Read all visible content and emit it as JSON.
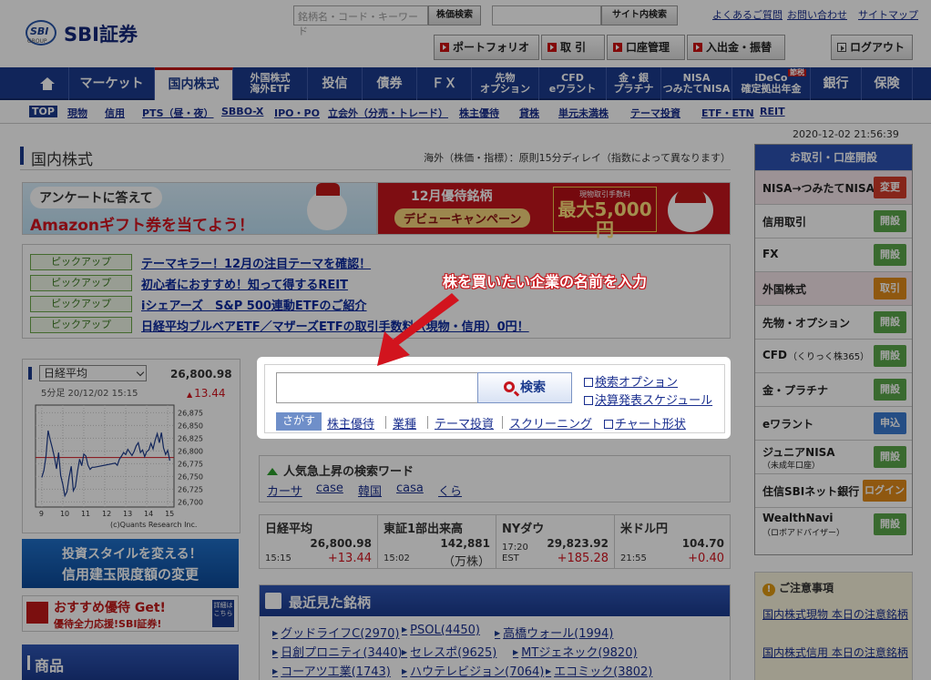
{
  "header": {
    "logo_badge": "SBI",
    "logo_sub": "GROUP",
    "logo_text": "SBI証券",
    "stock_search_placeholder": "銘柄名・コード・キーワード",
    "stock_search_btn": "株価検索",
    "site_search_btn": "サイト内検索",
    "links": [
      "よくあるご質問",
      "お問い合わせ",
      "サイトマップ"
    ],
    "buttons": [
      "ポートフォリオ",
      "取 引",
      "口座管理",
      "入出金・振替"
    ],
    "logout": "ログアウト"
  },
  "nav": {
    "items": [
      "マーケット",
      "国内株式",
      "外国株式\n海外ETF",
      "投信",
      "債券",
      "ＦＸ",
      "先物\nオプション",
      "CFD\neワラント",
      "金・銀\nプラチナ",
      "NISA\nつみたてNISA",
      "iDeCo\n確定拠出年金",
      "銀行",
      "保険"
    ],
    "ideco_badge": "節税"
  },
  "subnav": [
    "TOP",
    "現物",
    "信用",
    "PTS（昼・夜）",
    "SBBO-X",
    "IPO・PO",
    "立会外（分売・トレード）",
    "株主優待",
    "貸株",
    "単元未満株",
    "テーマ投資",
    "ETF・ETN",
    "REIT"
  ],
  "timestamp": "2020-12-02 21:56:39",
  "page": {
    "title": "国内株式",
    "note": "海外（株価・指標）：原則15分ディレイ（指数によって異なります）"
  },
  "banners": {
    "amazon_a": "アンケートに答えて",
    "amazon_b": "Amazonギフト券を当てよう！",
    "dec_a": "12月優待銘柄",
    "dec_b": "デビューキャンペーン",
    "dec_c1": "現物取引手数料",
    "dec_c2": "最大5,000円",
    "dec_c3": "キャッシュバック！"
  },
  "pickup": {
    "tag": "ピックアップ",
    "items": [
      "テーマキラー！12月の注目テーマを確認！",
      "初心者におすすめ！知って得するREIT",
      "iシェアーズ　S&P 500連動ETFのご紹介",
      "日経平均ブルベアETF／マザーズETFの取引手数料（現物・信用）0円！"
    ]
  },
  "annotation": "株を買いたい企業の名前を入力",
  "search": {
    "input_value": "",
    "button": "検索",
    "links": [
      "検索オプション",
      "決算発表スケジュール"
    ],
    "tabs": [
      "さがす",
      "株主優待",
      "業種",
      "テーマ投資",
      "スクリーニング",
      "チャート形状"
    ]
  },
  "index_chart": {
    "selected": "日経平均",
    "value": "26,800.98",
    "time": "5分足 20/12/02 15:15",
    "change": "13.44",
    "copyright": "(c)Quants Research Inc."
  },
  "chart_data": {
    "type": "line",
    "x": [
      9,
      9.1,
      9.2,
      9.3,
      9.4,
      9.5,
      9.6,
      9.7,
      9.8,
      9.9,
      10,
      10.1,
      10.2,
      10.3,
      10.4,
      10.5,
      10.6,
      10.7,
      10.8,
      10.9,
      11,
      11.1,
      11.2,
      11.3,
      11.4,
      11.5,
      12.5,
      12.6,
      12.7,
      12.8,
      12.9,
      13,
      13.1,
      13.2,
      13.3,
      13.4,
      13.5,
      13.6,
      13.7,
      13.8,
      13.9,
      14,
      14.1,
      14.2,
      14.3,
      14.4,
      14.5,
      14.6,
      14.7,
      14.8,
      14.9,
      15,
      15.1
    ],
    "y": [
      26748,
      26762,
      26790,
      26840,
      26822,
      26806,
      26788,
      26765,
      26797,
      26752,
      26735,
      26712,
      26720,
      26748,
      26770,
      26722,
      26730,
      26760,
      26784,
      26771,
      26794,
      26790,
      26772,
      26764,
      26768,
      26768,
      26776,
      26772,
      26784,
      26790,
      26797,
      26793,
      26803,
      26797,
      26791,
      26799,
      26810,
      26816,
      26797,
      26802,
      26789,
      26799,
      26802,
      26815,
      26804,
      26821,
      26834,
      26816,
      26836,
      26806,
      26793,
      26801,
      26781
    ],
    "reference": 26787,
    "xlim": [
      8.7,
      15.3
    ],
    "ylim": [
      26690,
      26890
    ],
    "xticks": [
      "9",
      "10",
      "11",
      "12",
      "13",
      "14",
      "15"
    ],
    "yticks": [
      "26,875",
      "26,850",
      "26,825",
      "26,800",
      "26,775",
      "26,750",
      "26,725",
      "26,700"
    ]
  },
  "indices": [
    {
      "name": "日経平均",
      "value": "26,800.98",
      "time": "15:15",
      "change": "+13.44"
    },
    {
      "name": "東証1部出来高",
      "value": "142,881",
      "time": "15:02",
      "change": "（万株）"
    },
    {
      "name": "NYダウ",
      "value": "29,823.92",
      "time": "17:20\nEST",
      "change": "+185.28"
    },
    {
      "name": "米ドル円",
      "value": "104.70",
      "time": "21:55",
      "change": "+0.40"
    }
  ],
  "popular": {
    "title": "人気急上昇の検索ワード",
    "words": [
      "カーサ",
      "case",
      "韓国",
      "casa",
      "くら"
    ]
  },
  "recent": {
    "title": "最近見た銘柄",
    "items": [
      "グッドライフC(2970)",
      "PSOL(4450)",
      "高橋ウォール(1994)",
      "日創プロニティ(3440)",
      "セレスポ(9625)",
      "MTジェネック(9820)",
      "コーアツ工業(1743)",
      "ハウテレビジョン(7064)",
      "エコミック(3802)"
    ]
  },
  "left_banners": {
    "style_a": "投資スタイルを変える！",
    "style_b": "信用建玉限度額の変更",
    "yutai_a": "おすすめ優待 Get!",
    "yutai_b": "優待全力応援!SBI証券!",
    "yutai_c": "詳細は\nこちら",
    "products": "商品"
  },
  "account_panel": {
    "title": "お取引・口座開設",
    "rows": [
      {
        "label": "NISA→つみたてNISA",
        "btn": "変更",
        "sub": ""
      },
      {
        "label": "信用取引",
        "btn": "開設",
        "sub": ""
      },
      {
        "label": "FX",
        "btn": "開設",
        "sub": ""
      },
      {
        "label": "外国株式",
        "btn": "取引",
        "sub": ""
      },
      {
        "label": "先物・オプション",
        "btn": "開設",
        "sub": ""
      },
      {
        "label": "CFD",
        "btn": "開設",
        "sub": "（くりっく株365）"
      },
      {
        "label": "金・プラチナ",
        "btn": "開設",
        "sub": ""
      },
      {
        "label": "eワラント",
        "btn": "申込",
        "sub": ""
      },
      {
        "label": "ジュニアNISA",
        "btn": "開設",
        "sub": "（未成年口座）"
      },
      {
        "label": "住信SBIネット銀行",
        "btn": "ログイン",
        "sub": ""
      },
      {
        "label": "WealthNavi",
        "btn": "開設",
        "sub": "（ロボアドバイザー）"
      }
    ]
  },
  "caution": {
    "title": "ご注意事項",
    "items": [
      "国内株式現物 本日の注意銘柄",
      "国内株式信用 本日の注意銘柄"
    ]
  }
}
